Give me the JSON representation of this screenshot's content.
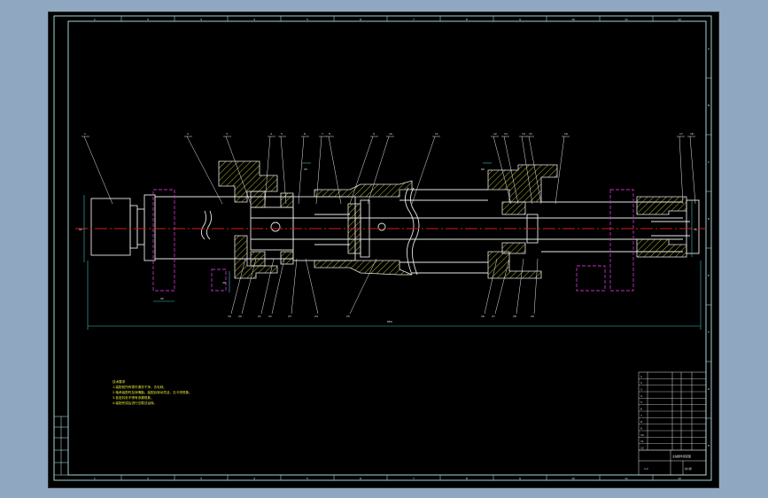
{
  "window": {
    "title": "CAD drawing viewport"
  },
  "colors": {
    "background": "#000000",
    "frame": "#9fd3d3",
    "part": "#e8e8e8",
    "hatch": "#b8b830",
    "center": "#d02020",
    "hidden": "#c030c0",
    "dimension": "#40c0c0",
    "note": "#e8e836"
  },
  "drawing": {
    "zone_numbers_top": [
      "1",
      "2",
      "3",
      "4",
      "5",
      "6",
      "7",
      "8",
      "9",
      "10",
      "11",
      "12"
    ],
    "zone_letters_right": [
      "A",
      "B",
      "C",
      "D",
      "E",
      "F",
      "G",
      "H"
    ],
    "balloons_top": [
      "1",
      "2",
      "3",
      "4",
      "5",
      "6",
      "7",
      "8",
      "9",
      "10",
      "11",
      "12",
      "13",
      "14",
      "15",
      "16",
      "17",
      "18"
    ],
    "balloons_bottom": [
      "19",
      "20",
      "21",
      "22",
      "23",
      "24",
      "25",
      "26",
      "27",
      "28",
      "29"
    ],
    "dimensions": {
      "overall_length": "880",
      "left_height": "92",
      "right_height": "50",
      "flange_width": "90",
      "small_a": "40",
      "small_b": "20",
      "small_c": "60"
    },
    "tech_notes": [
      "技术要求",
      "1.装配前所有零件清洗干净，去毛刺。",
      "2.轴承装配时加润滑脂，装配后转动灵活，无卡滞现象。",
      "3.各密封处不得有渗漏现象。",
      "4.装配完成后进行空载试运转。"
    ],
    "title_block": {
      "drawing_title": "主轴部件装配图",
      "scale": "1:2",
      "sheet": "共1张"
    },
    "bom_rows": [
      "1",
      "2",
      "3",
      "4",
      "5",
      "6",
      "7",
      "8",
      "9",
      "10",
      "11",
      "12"
    ]
  }
}
